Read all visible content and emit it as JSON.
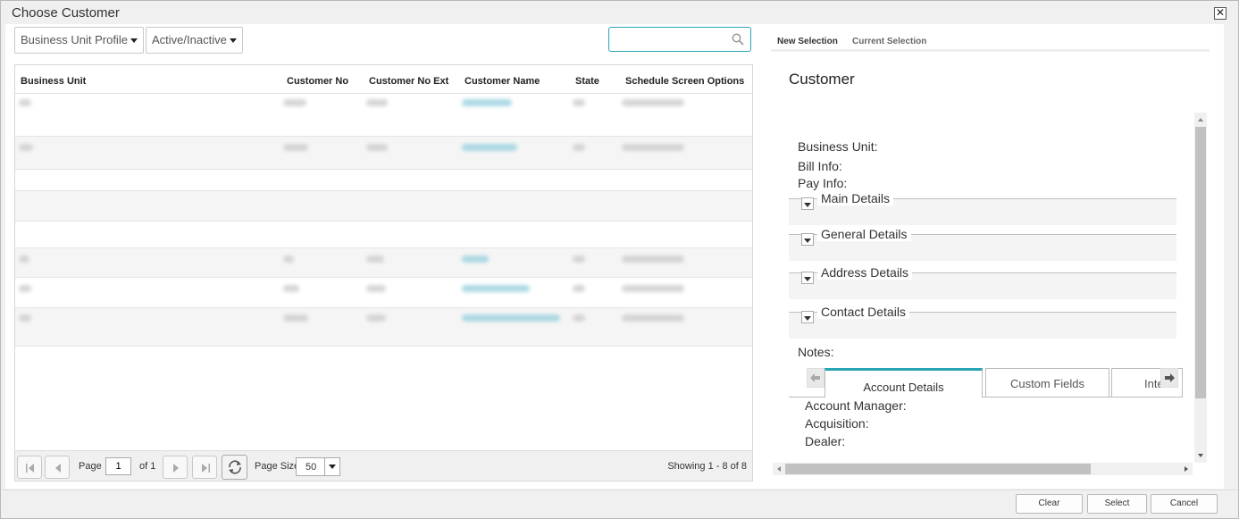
{
  "window": {
    "title": "Choose Customer",
    "close_label": "✕"
  },
  "filters": {
    "business_unit_profile": "Business Unit Profile",
    "active_inactive": "Active/Inactive",
    "search_placeholder": ""
  },
  "grid": {
    "columns": [
      "Business Unit",
      "Customer No",
      "Customer No Ext",
      "Customer Name",
      "State",
      "Schedule Screen Options"
    ]
  },
  "pager": {
    "page_label": "Page",
    "page_value": "1",
    "of_label": "of 1",
    "page_size_label": "Page Size",
    "page_size_value": "50",
    "showing": "Showing 1 - 8 of 8"
  },
  "right_tabs": {
    "new_selection": "New Selection",
    "current_selection": "Current Selection"
  },
  "customer": {
    "title": "Customer",
    "business_unit_label": "Business Unit:",
    "bill_info_label": "Bill Info:",
    "pay_info_label": "Pay Info:",
    "sections": [
      "Main Details",
      "General Details",
      "Address Details",
      "Contact Details"
    ],
    "notes_label": "Notes:",
    "inner_tabs": [
      "Account Details",
      "Custom Fields",
      "Inte"
    ],
    "account_manager_label": "Account Manager:",
    "acquisition_label": "Acquisition:",
    "dealer_label": "Dealer:"
  },
  "footer": {
    "clear": "Clear",
    "select": "Select",
    "cancel": "Cancel"
  },
  "colors": {
    "accent": "#2aa5b5",
    "link": "#9fd3e0"
  }
}
